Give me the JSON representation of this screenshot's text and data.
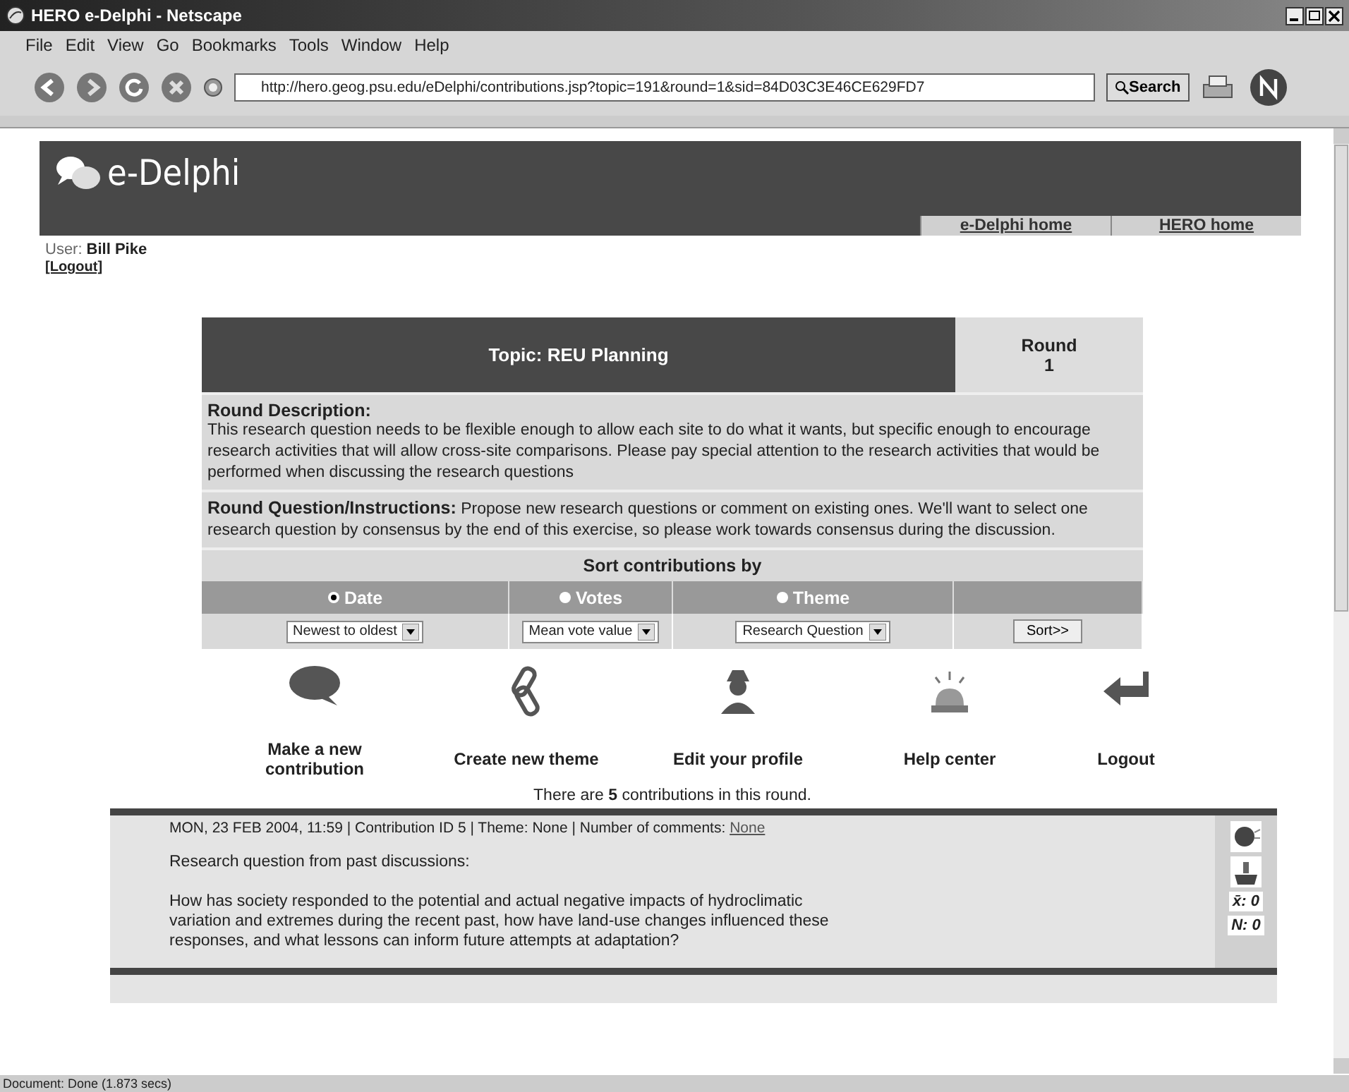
{
  "window": {
    "title": "HERO e-Delphi - Netscape"
  },
  "menu": [
    "File",
    "Edit",
    "View",
    "Go",
    "Bookmarks",
    "Tools",
    "Window",
    "Help"
  ],
  "toolbar": {
    "url": "http://hero.geog.psu.edu/eDelphi/contributions.jsp?topic=191&round=1&sid=84D03C3E46CE629FD7",
    "search_button": "Search"
  },
  "header": {
    "logo": "e-Delphi",
    "links": [
      "e-Delphi home",
      "HERO home"
    ]
  },
  "user": {
    "label": "User:",
    "name": "Bill Pike",
    "logout": "[Logout]"
  },
  "topic": {
    "title": "Topic: REU Planning",
    "round_label": "Round",
    "round_number": "1",
    "description_heading": "Round Description:",
    "description": "This research question needs to be flexible enough to allow each site to do what it wants, but specific enough to encourage research activities that will allow cross-site comparisons. Please pay special attention to the research activities that would be performed when discussing the research questions",
    "instructions": "**Round Question/Instructions:**  Propose new research questions or comment on existing ones. We'll want to select one research question by consensus by the end of this exercise, so please work towards consensus during the discussion."
  },
  "sort": {
    "heading": "Sort contributions by",
    "options": [
      {
        "label": "Date",
        "selected": true,
        "choice": "Newest to oldest"
      },
      {
        "label": "Votes",
        "selected": false,
        "choice": "Mean vote value"
      },
      {
        "label": "Theme",
        "selected": false,
        "choice": "Research Question"
      }
    ],
    "button": "Sort>>"
  },
  "actions": [
    {
      "kind": "speech",
      "label": "Make a new contribution"
    },
    {
      "kind": "clip",
      "label": "Create new theme"
    },
    {
      "kind": "person",
      "label": "Edit your profile"
    },
    {
      "kind": "bell",
      "label": "Help center"
    },
    {
      "kind": "back",
      "label": "Logout"
    }
  ],
  "count_text": "There are **5** contributions in this round.",
  "contributions": [
    {
      "meta": "MON, 23 FEB 2004, 11:59 | Contribution ID 5 | Theme: None | Number of comments: ",
      "comments_link": "None",
      "title": "Research question from past discussions:",
      "body": "How has society responded to the potential and actual negative impacts of hydroclimatic variation and extremes during the recent past, how have land-use changes influenced these responses, and what lessons can inform future attempts at adaptation?",
      "mean": "x̄: 0",
      "n": "N: 0"
    }
  ],
  "status_bar": "Document: Done (1.873 secs)"
}
